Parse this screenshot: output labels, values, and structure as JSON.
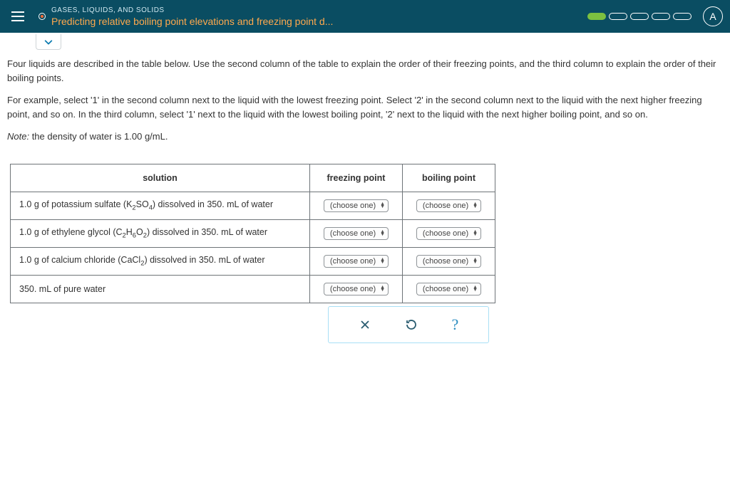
{
  "header": {
    "category": "GASES, LIQUIDS, AND SOLIDS",
    "title": "Predicting relative boiling point elevations and freezing point d..."
  },
  "instructions": {
    "p1": "Four liquids are described in the table below. Use the second column of the table to explain the order of their freezing points, and the third column to explain the order of their boiling points.",
    "p2": "For example, select '1' in the second column next to the liquid with the lowest freezing point. Select '2' in the second column next to the liquid with the next higher freezing point, and so on. In the third column, select '1' next to the liquid with the lowest boiling point, '2' next to the liquid with the next higher boiling point, and so on.",
    "note_prefix": "Note:",
    "note_body": " the density of water is ",
    "note_value": "1.00 g/mL",
    "note_end": "."
  },
  "table": {
    "headers": {
      "solution": "solution",
      "freezing": "freezing point",
      "boiling": "boiling point"
    },
    "select_placeholder": "(choose one)",
    "rows": [
      {
        "html": "1.0 g of potassium sulfate (K<sub>2</sub>SO<sub>4</sub>) dissolved in 350. mL of water"
      },
      {
        "html": "1.0 g of ethylene glycol (C<sub>2</sub>H<sub>6</sub>O<sub>2</sub>) dissolved in 350. mL of water"
      },
      {
        "html": "1.0 g of calcium chloride (CaCl<sub>2</sub>) dissolved in 350. mL of water"
      },
      {
        "html": "350. mL of pure water"
      }
    ]
  },
  "actions": {
    "clear": "×",
    "help": "?"
  }
}
